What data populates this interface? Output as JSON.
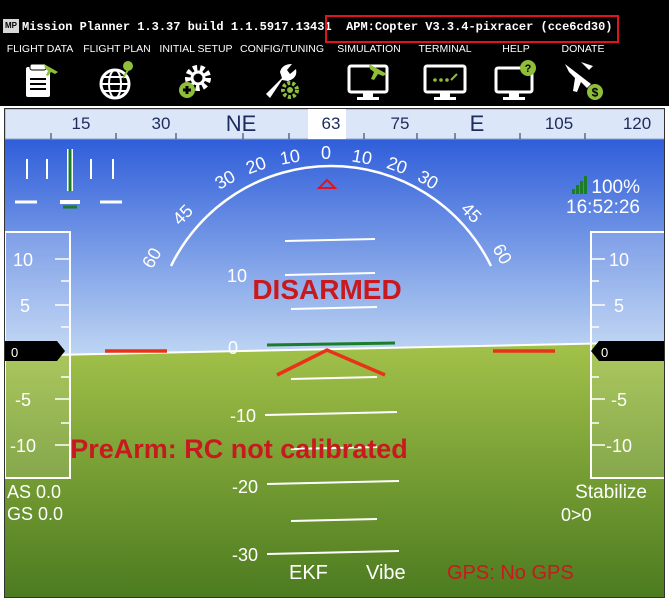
{
  "window": {
    "title": "Mission Planner 1.3.37 build 1.1.5917.13431",
    "version": "APM:Copter V3.3.4-pixracer (cce6cd30)",
    "app_icon_label": "MP"
  },
  "toolbar": {
    "items": [
      {
        "label": "FLIGHT DATA",
        "icon": "clipboard-plane-icon"
      },
      {
        "label": "FLIGHT PLAN",
        "icon": "globe-pin-icon"
      },
      {
        "label": "INITIAL SETUP",
        "icon": "gear-plus-icon"
      },
      {
        "label": "CONFIG/TUNING",
        "icon": "wrench-gear-icon"
      },
      {
        "label": "SIMULATION",
        "icon": "monitor-plane-icon"
      },
      {
        "label": "TERMINAL",
        "icon": "monitor-terminal-icon"
      },
      {
        "label": "HELP",
        "icon": "monitor-help-icon"
      },
      {
        "label": "DONATE",
        "icon": "plane-dollar-icon"
      }
    ]
  },
  "hud": {
    "heading_ticks": [
      "15",
      "30",
      "NE",
      "63",
      "75",
      "E",
      "105",
      "120"
    ],
    "current_heading": "63",
    "roll_ticks": [
      "60",
      "45",
      "30",
      "20",
      "10",
      "0",
      "10",
      "20",
      "30",
      "45",
      "60"
    ],
    "pitch_labels": [
      "10",
      "0",
      "-10",
      "-20",
      "-30"
    ],
    "left_scale": [
      "10",
      "5",
      "0",
      "-5",
      "-10"
    ],
    "right_scale": [
      "10",
      "5",
      "0",
      "-5",
      "-10"
    ],
    "left_scale_value": "0",
    "right_scale_value": "0",
    "battery": "100%",
    "time": "16:52:26",
    "status": "DISARMED",
    "message": "PreArm: RC not calibrated",
    "airspeed": "AS 0.0",
    "groundspeed": "GS 0.0",
    "mode": "Stabilize",
    "wp": "0>0",
    "ekf": "EKF",
    "vibe": "Vibe",
    "gps": "GPS: No GPS",
    "colors": {
      "sky_top": "#1b4dd6",
      "sky_bottom": "#bfd6f3",
      "ground_top": "#a3c24a",
      "ground_bottom": "#4b7a1f",
      "status_red": "#c8191e",
      "horizon_line": "#1b7d2a"
    }
  }
}
